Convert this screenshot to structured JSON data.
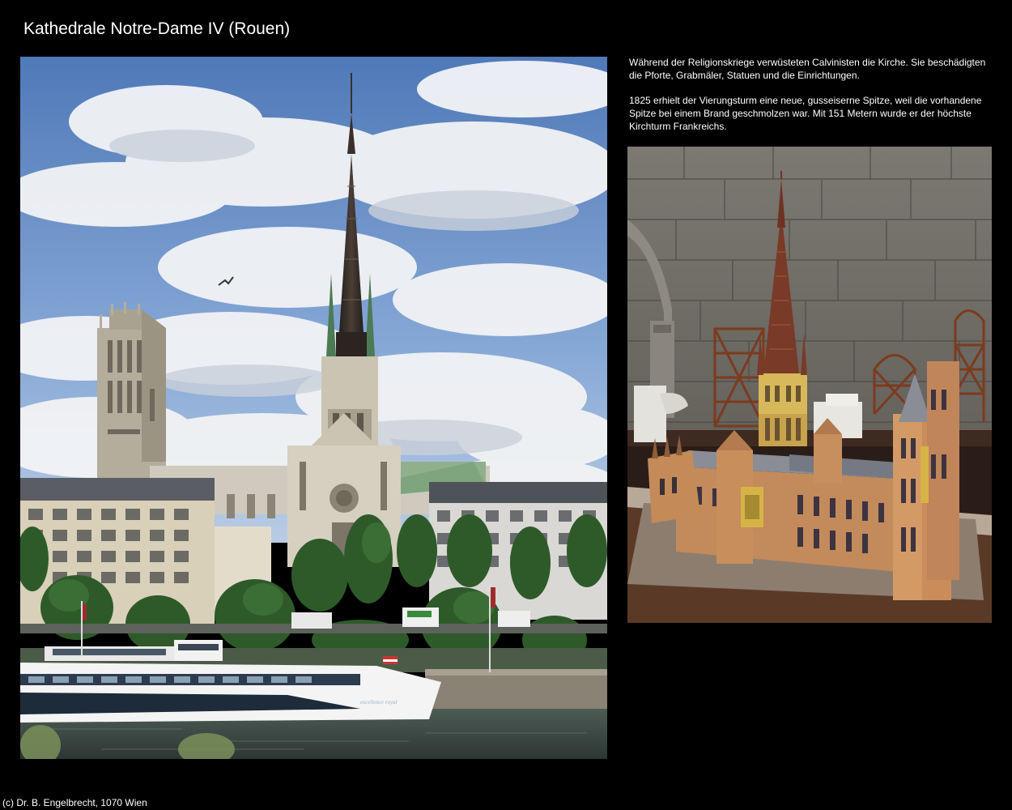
{
  "page": {
    "title": "Kathedrale Notre-Dame IV (Rouen)",
    "paragraphs": [
      "Während der Religionskriege verwüsteten Calvinisten die Kirche. Sie beschädigten die Pforte, Grabmäler, Statuen und die Einrichtungen.",
      "1825 erhielt der Vierungsturm eine neue, gusseiserne Spitze, weil die vorhandene Spitze bei einem Brand geschmolzen war. Mit 151 Metern wurde er der höchste Kirchturm Frankreichs."
    ],
    "footer": "(c) Dr. B. Engelbrecht, 1070 Wien",
    "ship_name": "excellence royal"
  }
}
